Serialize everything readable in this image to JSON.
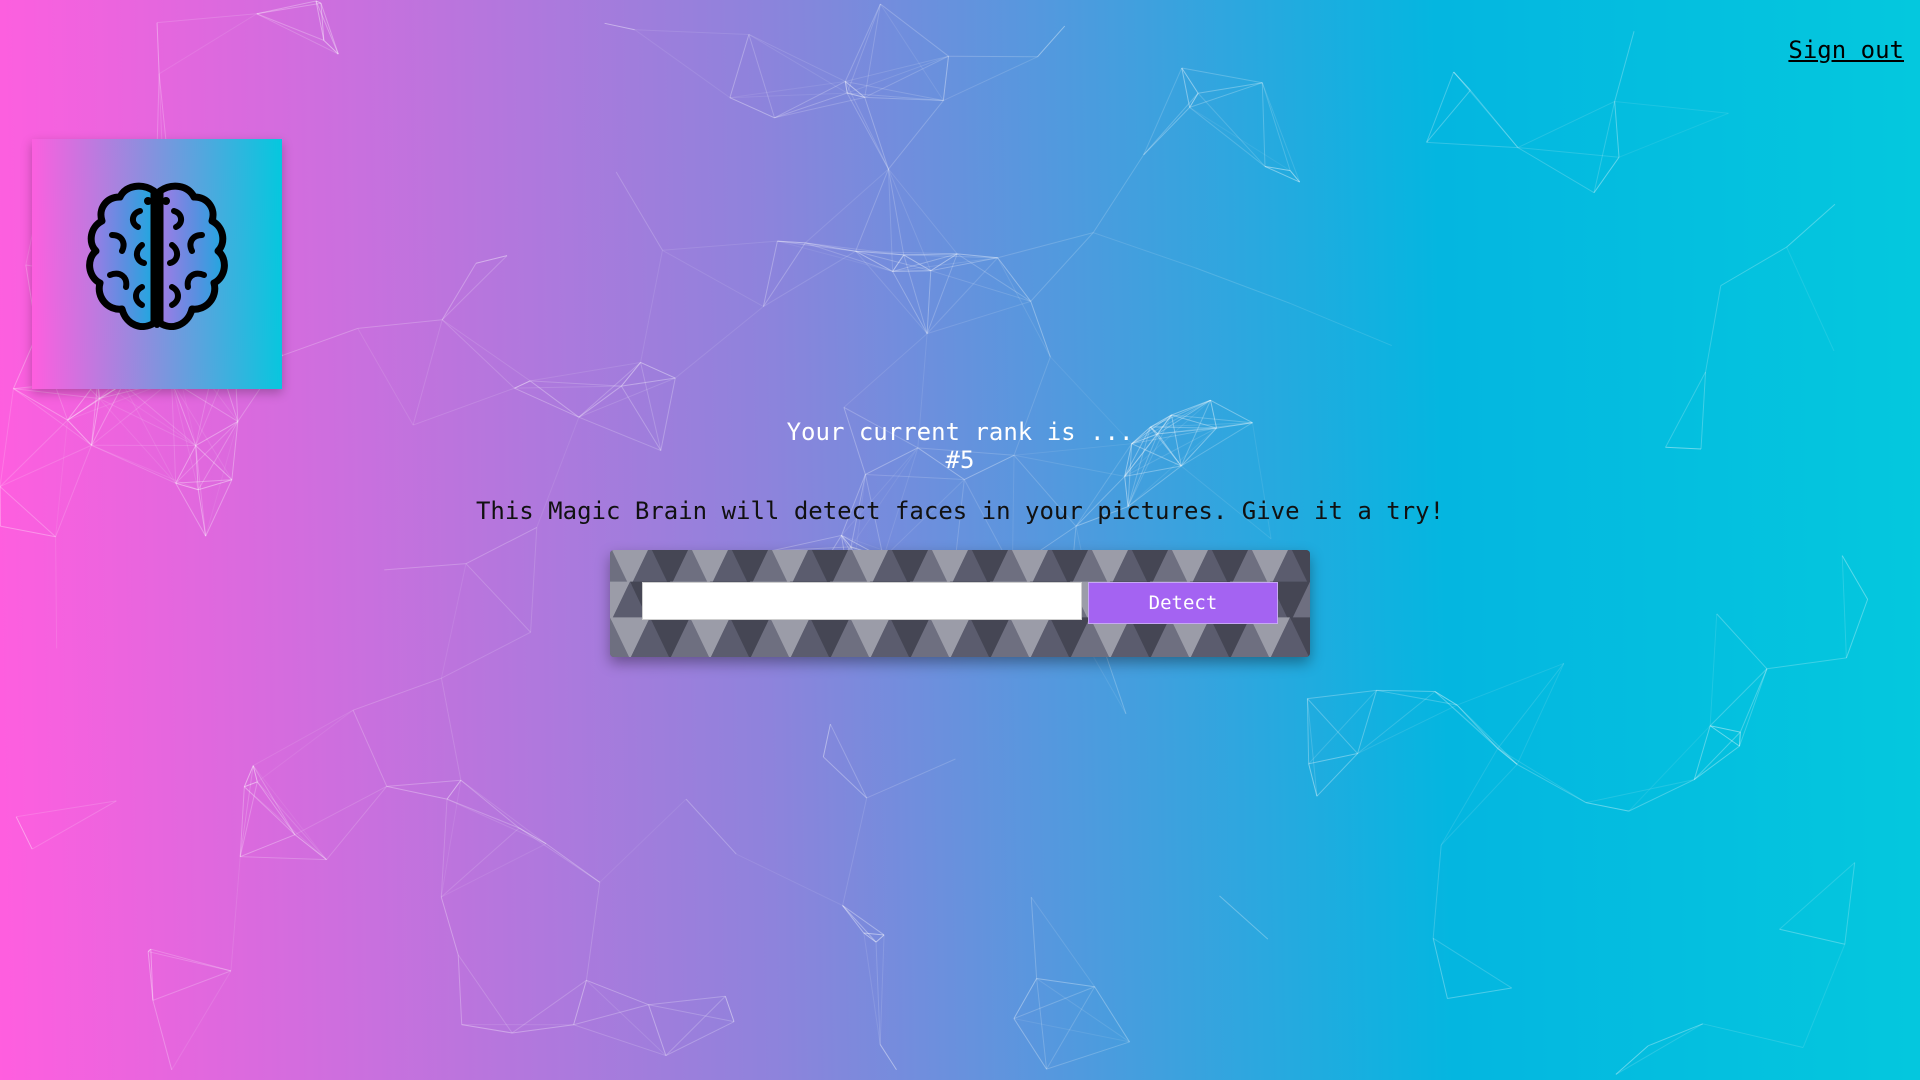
{
  "nav": {
    "sign_out_label": "Sign out"
  },
  "logo": {
    "icon": "brain-icon"
  },
  "rank": {
    "heading": "Your current rank is ...",
    "value": "#5"
  },
  "tagline": "This Magic Brain will detect faces in your pictures. Give it a try!",
  "form": {
    "input_value": "",
    "input_placeholder": "",
    "detect_label": "Detect"
  },
  "colors": {
    "gradient_start": "#ff5edf",
    "gradient_end": "#04c8de",
    "button": "#a463f2",
    "panel": "#5b5c6e"
  }
}
